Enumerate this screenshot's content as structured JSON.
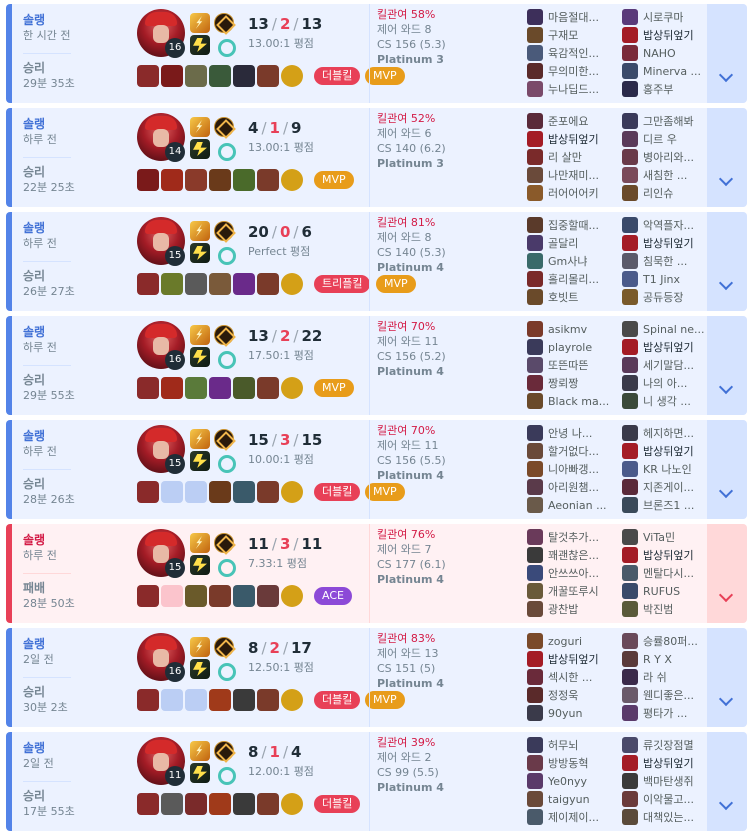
{
  "matches": [
    {
      "queue": "솔랭",
      "ago": "한 시간 전",
      "result": "승리",
      "duration": "29분 35초",
      "win": true,
      "level": "16",
      "kills": "13",
      "deaths": "2",
      "assists": "13",
      "kda_text": "13.00:1 평점",
      "kill_participation": "킬관여 58%",
      "control_wards": "제어 와드 8",
      "cs": "CS 156 (5.3)",
      "tier": "Platinum 3",
      "badges": [
        {
          "label": "더블킬",
          "color": "#e84057"
        },
        {
          "label": "MVP",
          "color": "#e89c1a"
        }
      ],
      "items": [
        {
          "color": "#8a2a2a"
        },
        {
          "color": "#7a1a1a"
        },
        {
          "color": "#6b6b4a"
        },
        {
          "color": "#3a5a3a"
        },
        {
          "color": "#2a2a3a"
        },
        {
          "color": "#7a3a2a"
        },
        {
          "color": "#d4a017",
          "trinket": true
        }
      ],
      "team1": [
        {
          "name": "마음절대...",
          "color": "#3d2f5a"
        },
        {
          "name": "구재모",
          "color": "#6a4a2a"
        },
        {
          "name": "육감적인...",
          "color": "#4a5a7a"
        },
        {
          "name": "무의미한...",
          "color": "#5a2a2a"
        },
        {
          "name": "누나딥드...",
          "color": "#7a4a6a"
        }
      ],
      "team2": [
        {
          "name": "시로쿠마",
          "color": "#5a3a7a"
        },
        {
          "name": "밥상뒤엎기",
          "color": "#a41c26",
          "me": true
        },
        {
          "name": "NAHO",
          "color": "#7a2a3a"
        },
        {
          "name": "Minerva ...",
          "color": "#3a4a6a"
        },
        {
          "name": "홍주부",
          "color": "#2a2a4a"
        }
      ]
    },
    {
      "queue": "솔랭",
      "ago": "하루 전",
      "result": "승리",
      "duration": "22분 25초",
      "win": true,
      "level": "14",
      "kills": "4",
      "deaths": "1",
      "assists": "9",
      "kda_text": "13.00:1 평점",
      "kill_participation": "킬관여 52%",
      "control_wards": "제어 와드 6",
      "cs": "CS 140 (6.2)",
      "tier": "Platinum 3",
      "badges": [
        {
          "label": "MVP",
          "color": "#e89c1a"
        }
      ],
      "items": [
        {
          "color": "#7a1a1a"
        },
        {
          "color": "#a02a1a"
        },
        {
          "color": "#8a3a2a"
        },
        {
          "color": "#6a3a1a"
        },
        {
          "color": "#4a6a2a"
        },
        {
          "color": "#7a3a2a"
        },
        {
          "color": "#d4a017",
          "trinket": true
        }
      ],
      "team1": [
        {
          "name": "준포에요",
          "color": "#5a2a3a"
        },
        {
          "name": "밥상뒤엎기",
          "color": "#a41c26",
          "me": true
        },
        {
          "name": "리 살만",
          "color": "#7a2a2a"
        },
        {
          "name": "나만재미...",
          "color": "#6a4a3a"
        },
        {
          "name": "러어어어키",
          "color": "#8a5a2a"
        }
      ],
      "team2": [
        {
          "name": "그만좀해봐",
          "color": "#3a3a5a"
        },
        {
          "name": "디르 우",
          "color": "#5a3a5a"
        },
        {
          "name": "병아리와...",
          "color": "#6a3a4a"
        },
        {
          "name": "새침한 ...",
          "color": "#7a4a5a"
        },
        {
          "name": "리인슈",
          "color": "#6a4a2a"
        }
      ]
    },
    {
      "queue": "솔랭",
      "ago": "하루 전",
      "result": "승리",
      "duration": "26분 27초",
      "win": true,
      "level": "15",
      "kills": "20",
      "deaths": "0",
      "assists": "6",
      "kda_text": "Perfect 평점",
      "kill_participation": "킬관여 81%",
      "control_wards": "제어 와드 8",
      "cs": "CS 140 (5.3)",
      "tier": "Platinum 4",
      "badges": [
        {
          "label": "트리플킬",
          "color": "#e84057"
        },
        {
          "label": "MVP",
          "color": "#e89c1a"
        }
      ],
      "items": [
        {
          "color": "#8a2a2a"
        },
        {
          "color": "#6a7a2a"
        },
        {
          "color": "#5a5a5a"
        },
        {
          "color": "#7a5a3a"
        },
        {
          "color": "#6a2a8a"
        },
        {
          "color": "#7a3a2a"
        },
        {
          "color": "#d4a017",
          "trinket": true
        }
      ],
      "team1": [
        {
          "name": "집중할때...",
          "color": "#5a3a2a"
        },
        {
          "name": "골달리",
          "color": "#4a3a6a"
        },
        {
          "name": "Gm사냐",
          "color": "#3a6a6a"
        },
        {
          "name": "홀리몰리...",
          "color": "#7a2a2a"
        },
        {
          "name": "호빗트",
          "color": "#6a4a2a"
        }
      ],
      "team2": [
        {
          "name": "악역플자...",
          "color": "#3a4a6a"
        },
        {
          "name": "밥상뒤엎기",
          "color": "#a41c26",
          "me": true
        },
        {
          "name": "침묵한 ...",
          "color": "#5a5a6a"
        },
        {
          "name": "T1 Jinx",
          "color": "#4a5a8a"
        },
        {
          "name": "공듀등장",
          "color": "#7a5a2a"
        }
      ]
    },
    {
      "queue": "솔랭",
      "ago": "하루 전",
      "result": "승리",
      "duration": "29분 55초",
      "win": true,
      "level": "16",
      "kills": "13",
      "deaths": "2",
      "assists": "22",
      "kda_text": "17.50:1 평점",
      "kill_participation": "킬관여 70%",
      "control_wards": "제어 와드 11",
      "cs": "CS 156 (5.2)",
      "tier": "Platinum 4",
      "badges": [
        {
          "label": "MVP",
          "color": "#e89c1a"
        }
      ],
      "items": [
        {
          "color": "#8a2a2a"
        },
        {
          "color": "#a02a1a"
        },
        {
          "color": "#5a7a3a"
        },
        {
          "color": "#6a2a8a"
        },
        {
          "color": "#4a5a2a"
        },
        {
          "color": "#7a3a2a"
        },
        {
          "color": "#d4a017",
          "trinket": true
        }
      ],
      "team1": [
        {
          "name": "asikmv",
          "color": "#7a3a2a"
        },
        {
          "name": "playrole",
          "color": "#3a3a5a"
        },
        {
          "name": "또뜬따뜬",
          "color": "#5a4a6a"
        },
        {
          "name": "짱뢰짱",
          "color": "#6a2a3a"
        },
        {
          "name": "Black ma...",
          "color": "#6a4a2a"
        }
      ],
      "team2": [
        {
          "name": "Spinal ne...",
          "color": "#4a4a4a"
        },
        {
          "name": "밥상뒤엎기",
          "color": "#a41c26",
          "me": true
        },
        {
          "name": "세기말담...",
          "color": "#5a3a5a"
        },
        {
          "name": "나의 아...",
          "color": "#3a3a4a"
        },
        {
          "name": "니 생각 ...",
          "color": "#3a4a3a"
        }
      ]
    },
    {
      "queue": "솔랭",
      "ago": "하루 전",
      "result": "승리",
      "duration": "28분 26초",
      "win": true,
      "level": "15",
      "kills": "15",
      "deaths": "3",
      "assists": "15",
      "kda_text": "10.00:1 평점",
      "kill_participation": "킬관여 70%",
      "control_wards": "제어 와드 11",
      "cs": "CS 156 (5.5)",
      "tier": "Platinum 4",
      "badges": [
        {
          "label": "더블킬",
          "color": "#e84057"
        },
        {
          "label": "MVP",
          "color": "#e89c1a"
        }
      ],
      "items": [
        {
          "color": "#8a2a2a"
        },
        {
          "empty": true
        },
        {
          "empty": true
        },
        {
          "color": "#6a3a1a"
        },
        {
          "color": "#3a5a6a"
        },
        {
          "color": "#7a3a2a"
        },
        {
          "color": "#d4a017",
          "trinket": true
        }
      ],
      "team1": [
        {
          "name": "안녕 나...",
          "color": "#3a3a5a"
        },
        {
          "name": "할거없다...",
          "color": "#6a4a3a"
        },
        {
          "name": "니아빠갱...",
          "color": "#7a4a2a"
        },
        {
          "name": "아리원챔...",
          "color": "#5a3a4a"
        },
        {
          "name": "Aeonian ...",
          "color": "#6a5a4a"
        }
      ],
      "team2": [
        {
          "name": "헤지하면...",
          "color": "#3a3a4a"
        },
        {
          "name": "밥상뒤엎기",
          "color": "#a41c26",
          "me": true
        },
        {
          "name": "KR 나노인",
          "color": "#4a5a8a"
        },
        {
          "name": "지존게이...",
          "color": "#5a2a3a"
        },
        {
          "name": "브론즈1 ...",
          "color": "#3a4a5a"
        }
      ]
    },
    {
      "queue": "솔랭",
      "ago": "하루 전",
      "result": "패배",
      "duration": "28분 50초",
      "win": false,
      "level": "15",
      "kills": "11",
      "deaths": "3",
      "assists": "11",
      "kda_text": "7.33:1 평점",
      "kill_participation": "킬관여 76%",
      "control_wards": "제어 와드 7",
      "cs": "CS 177 (6.1)",
      "tier": "Platinum 4",
      "badges": [
        {
          "label": "ACE",
          "color": "#8c4ad7"
        }
      ],
      "items": [
        {
          "color": "#8a2a2a"
        },
        {
          "empty": true
        },
        {
          "color": "#6a5a2a"
        },
        {
          "color": "#7a3a2a"
        },
        {
          "color": "#3a5a6a"
        },
        {
          "color": "#6a3a3a"
        },
        {
          "color": "#d4a017",
          "trinket": true
        }
      ],
      "team1": [
        {
          "name": "탈것추가...",
          "color": "#6a3a5a"
        },
        {
          "name": "꽤괜찮은...",
          "color": "#3a3a3a"
        },
        {
          "name": "안쓰쓰아...",
          "color": "#3a4a7a"
        },
        {
          "name": "개꿀또루시",
          "color": "#6a5a3a"
        },
        {
          "name": "광찬밥",
          "color": "#6a4a3a"
        }
      ],
      "team2": [
        {
          "name": "ViTa민",
          "color": "#4a4a4a"
        },
        {
          "name": "밥상뒤엎기",
          "color": "#a41c26",
          "me": true
        },
        {
          "name": "멘탈다시...",
          "color": "#4a5a6a"
        },
        {
          "name": "RUFUS",
          "color": "#3a4a6a"
        },
        {
          "name": "박진범",
          "color": "#5a5a3a"
        }
      ]
    },
    {
      "queue": "솔랭",
      "ago": "2일 전",
      "result": "승리",
      "duration": "30분 2초",
      "win": true,
      "level": "16",
      "kills": "8",
      "deaths": "2",
      "assists": "17",
      "kda_text": "12.50:1 평점",
      "kill_participation": "킬관여 83%",
      "control_wards": "제어 와드 13",
      "cs": "CS 151 (5)",
      "tier": "Platinum 4",
      "badges": [
        {
          "label": "더블킬",
          "color": "#e84057"
        },
        {
          "label": "MVP",
          "color": "#e89c1a"
        }
      ],
      "items": [
        {
          "color": "#8a2a2a"
        },
        {
          "empty": true
        },
        {
          "empty": true
        },
        {
          "color": "#a03a1a"
        },
        {
          "color": "#3a3a3a"
        },
        {
          "color": "#7a3a2a"
        },
        {
          "color": "#d4a017",
          "trinket": true
        }
      ],
      "team1": [
        {
          "name": "zoguri",
          "color": "#7a4a2a"
        },
        {
          "name": "밥상뒤엎기",
          "color": "#a41c26",
          "me": true
        },
        {
          "name": "섹시한 ...",
          "color": "#6a2a3a"
        },
        {
          "name": "정정욱",
          "color": "#5a2a2a"
        },
        {
          "name": "90yun",
          "color": "#3a3a4a"
        }
      ],
      "team2": [
        {
          "name": "승률80퍼...",
          "color": "#6a4a5a"
        },
        {
          "name": "R Y X",
          "color": "#5a3a3a"
        },
        {
          "name": "라 쉬",
          "color": "#3a2a4a"
        },
        {
          "name": "웬디좋은...",
          "color": "#6a5a6a"
        },
        {
          "name": "평타가 ...",
          "color": "#5a3a6a"
        }
      ]
    },
    {
      "queue": "솔랭",
      "ago": "2일 전",
      "result": "승리",
      "duration": "17분 55초",
      "win": true,
      "level": "11",
      "kills": "8",
      "deaths": "1",
      "assists": "4",
      "kda_text": "12.00:1 평점",
      "kill_participation": "킬관여 39%",
      "control_wards": "제어 와드 2",
      "cs": "CS 99 (5.5)",
      "tier": "Platinum 4",
      "badges": [
        {
          "label": "더블킬",
          "color": "#e84057"
        }
      ],
      "items": [
        {
          "color": "#8a2a2a"
        },
        {
          "color": "#5a5a5a"
        },
        {
          "color": "#7a2a2a"
        },
        {
          "color": "#a03a1a"
        },
        {
          "color": "#3a3a3a"
        },
        {
          "color": "#7a3a2a"
        },
        {
          "color": "#d4a017",
          "trinket": true
        }
      ],
      "team1": [
        {
          "name": "허무뇌",
          "color": "#3a3a5a"
        },
        {
          "name": "방방동혁",
          "color": "#6a3a4a"
        },
        {
          "name": "Ye0nyy",
          "color": "#5a3a6a"
        },
        {
          "name": "taigyun",
          "color": "#6a4a3a"
        },
        {
          "name": "제이제이...",
          "color": "#4a5a6a"
        }
      ],
      "team2": [
        {
          "name": "류깃장점멸",
          "color": "#4a4a6a"
        },
        {
          "name": "밥상뒤엎기",
          "color": "#a41c26",
          "me": true
        },
        {
          "name": "백마탄생쥐",
          "color": "#3a3a3a"
        },
        {
          "name": "이악물고...",
          "color": "#6a3a3a"
        },
        {
          "name": "대책있는...",
          "color": "#5a4a3a"
        }
      ]
    }
  ]
}
